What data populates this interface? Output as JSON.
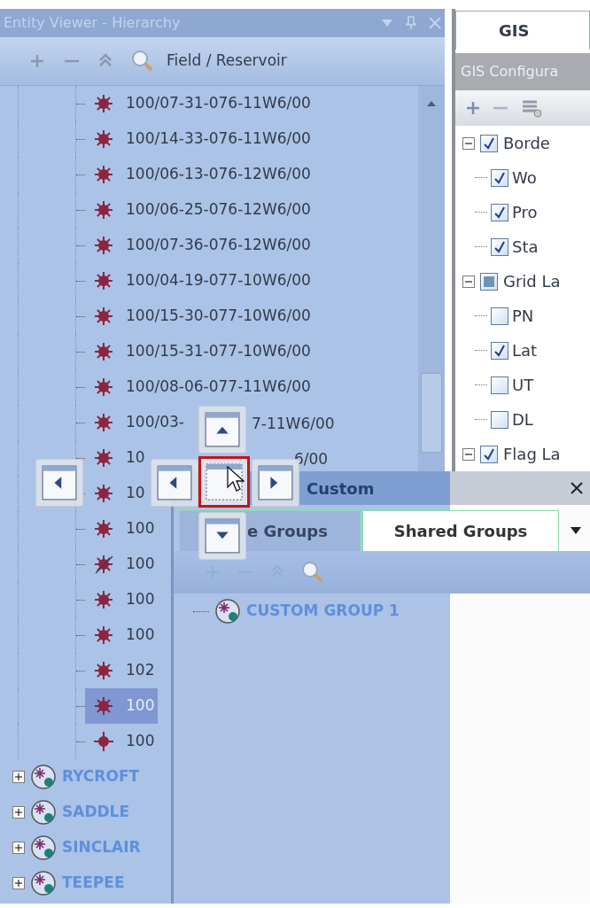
{
  "left_panel": {
    "title": "Entity Viewer - Hierarchy",
    "toolbar_label": "Field / Reservoir",
    "wells": [
      {
        "label": "100/07-31-076-11W6/00",
        "kind": "standard",
        "selected": false
      },
      {
        "label": "100/14-33-076-11W6/00",
        "kind": "standard",
        "selected": false
      },
      {
        "label": "100/06-13-076-12W6/00",
        "kind": "standard",
        "selected": false
      },
      {
        "label": "100/06-25-076-12W6/00",
        "kind": "standard",
        "selected": false
      },
      {
        "label": "100/07-36-076-12W6/00",
        "kind": "standard",
        "selected": false
      },
      {
        "label": "100/04-19-077-10W6/00",
        "kind": "standard",
        "selected": false
      },
      {
        "label": "100/15-30-077-10W6/00",
        "kind": "standard",
        "selected": false
      },
      {
        "label": "100/15-31-077-10W6/00",
        "kind": "standard",
        "selected": false
      },
      {
        "label": "100/08-06-077-11W6/00",
        "kind": "standard",
        "selected": false
      },
      {
        "label": "100/03-",
        "tail": "7-11W6/00",
        "kind": "standard",
        "selected": false
      },
      {
        "label": "10",
        "tail": "6/00",
        "kind": "standard",
        "selected": false
      },
      {
        "label": "10",
        "kind": "standard",
        "selected": false
      },
      {
        "label": "100",
        "kind": "standard",
        "selected": false
      },
      {
        "label": "100",
        "kind": "struck",
        "selected": false
      },
      {
        "label": "100",
        "kind": "standard",
        "selected": false
      },
      {
        "label": "100",
        "kind": "standard",
        "selected": false
      },
      {
        "label": "102",
        "kind": "standard",
        "selected": false
      },
      {
        "label": "100",
        "kind": "standard",
        "selected": true
      },
      {
        "label": "100",
        "kind": "cross",
        "selected": false
      }
    ],
    "fields": [
      {
        "label": "RYCROFT",
        "expanded": false
      },
      {
        "label": "SADDLE",
        "expanded": false
      },
      {
        "label": "SINCLAIR",
        "expanded": false
      },
      {
        "label": "TEEPEE",
        "expanded": false
      }
    ]
  },
  "right_panel": {
    "tab": "GIS",
    "header": "GIS Configura",
    "layers": [
      {
        "label": "Borde",
        "checked": true,
        "expanded": true,
        "children": [
          {
            "label": "Wo",
            "checked": true
          },
          {
            "label": "Pro",
            "checked": true
          },
          {
            "label": "Sta",
            "checked": true
          }
        ]
      },
      {
        "label": "Grid La",
        "checked": false,
        "partial": true,
        "expanded": true,
        "children": [
          {
            "label": "PN",
            "checked": false
          },
          {
            "label": "Lat",
            "checked": true
          },
          {
            "label": "UT",
            "checked": false
          },
          {
            "label": "DL",
            "checked": false
          }
        ]
      },
      {
        "label": "Flag La",
        "checked": true,
        "expanded": true
      }
    ]
  },
  "custom_window": {
    "title": "Custom",
    "tabs": [
      {
        "label": "e Groups",
        "selected": false
      },
      {
        "label": "Shared Groups",
        "selected": true
      }
    ],
    "groups": [
      {
        "label": "CUSTOM GROUP 1"
      }
    ]
  }
}
